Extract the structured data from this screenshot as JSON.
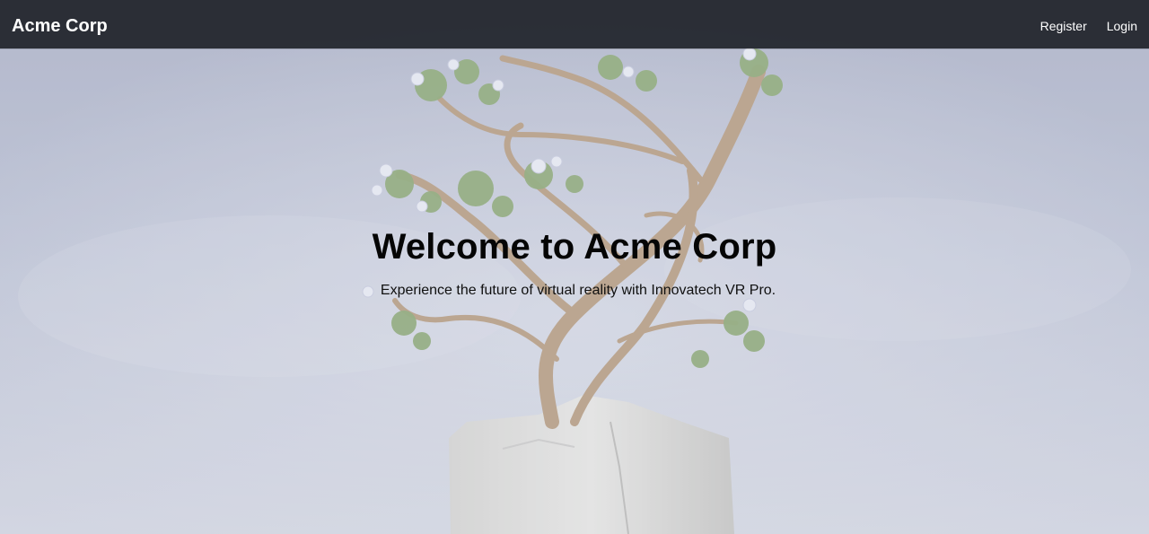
{
  "navbar": {
    "brand": "Acme Corp",
    "links": [
      {
        "label": "Register"
      },
      {
        "label": "Login"
      }
    ]
  },
  "hero": {
    "title": "Welcome to Acme Corp",
    "subtitle": "Experience the future of virtual reality with Innovatech VR Pro.",
    "background_image": "bonsai-tree-on-stone-pedestal"
  },
  "colors": {
    "navbar_bg": "#1c1f26",
    "nav_text": "#ffffff",
    "sky": "#b9bfd3",
    "title_text": "#050505"
  }
}
